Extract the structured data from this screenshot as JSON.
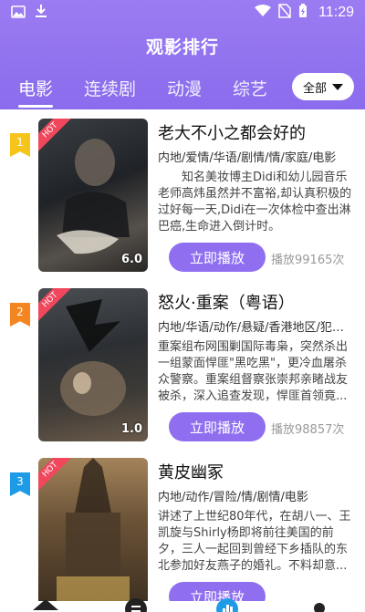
{
  "status_bar": {
    "time": "11:29"
  },
  "header": {
    "title": "观影排行",
    "tabs": [
      {
        "label": "电影",
        "active": true
      },
      {
        "label": "连续剧",
        "active": false
      },
      {
        "label": "动漫",
        "active": false
      },
      {
        "label": "综艺",
        "active": false
      }
    ],
    "filter": {
      "label": "全部"
    }
  },
  "colors": {
    "accent": "#8f6ff0",
    "header": "#9b7cf2",
    "hot": "#f0475c"
  },
  "items": [
    {
      "rank": "1",
      "hot": "HOT",
      "score": "6.0",
      "title": "老大不小之都会好的",
      "tags": "内地/爱情/华语/剧情/情/家庭/电影",
      "desc": "知名美妆博主Didi和幼儿园音乐老师高炜虽然并不富裕,却认真积极的过好每一天,Didi在一次体检中查出淋巴癌,生命进入倒计时。",
      "play": "立即播放",
      "plays": "播放99165次"
    },
    {
      "rank": "2",
      "hot": "HOT",
      "score": "1.0",
      "title": "怒火·重案（粤语）",
      "tags": "内地/华语/动作/悬疑/香港地区/犯罪...",
      "desc": "重案组布网围剿国际毒枭，突然杀出一组蒙面悍匪\"黑吃黑\"，更冷血屠杀众警察。重案组督察张崇邦亲睹战友被杀，深入追查发现，悍匪首领竟...",
      "play": "立即播放",
      "plays": "播放98857次"
    },
    {
      "rank": "3",
      "hot": "HOT",
      "score": "",
      "title": "黄皮幽冢",
      "tags": "内地/动作/冒险/情/剧情/电影",
      "desc": "讲述了上世纪80年代，在胡八一、王凯旋与Shirly杨即将前往美国的前夕，三人一起回到曾经下乡插队的东北参加好友燕子的婚礼。不料却意...",
      "play": "立即播放",
      "plays": ""
    }
  ]
}
